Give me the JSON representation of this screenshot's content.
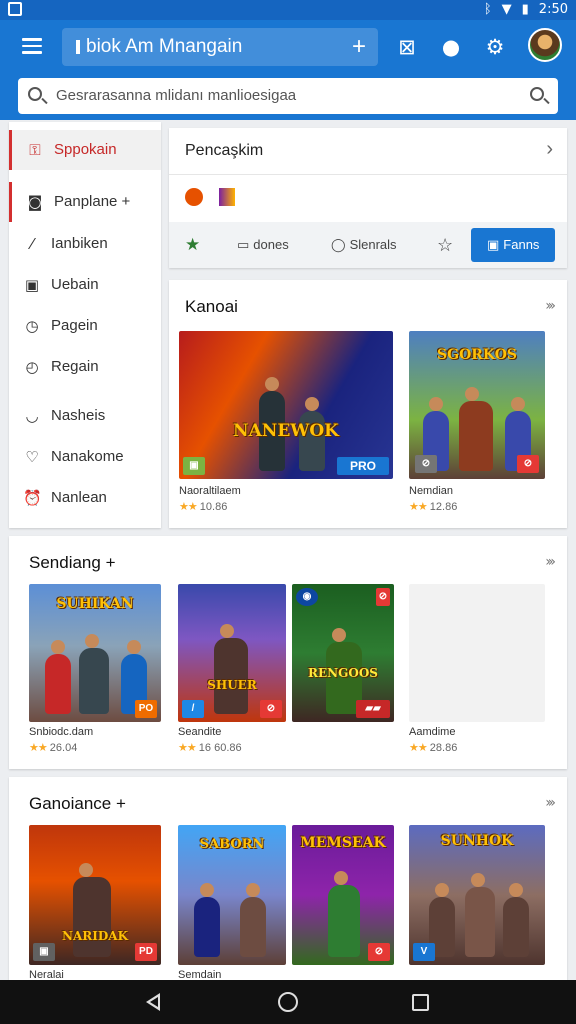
{
  "statusbar": {
    "time": "2:50"
  },
  "appbar": {
    "title": "biok Am Mnangain",
    "plus": "+"
  },
  "search": {
    "placeholder": "Gesrarasanna mlidanı manlioesigaa"
  },
  "sidebar": {
    "items": [
      {
        "label": "Sppokain",
        "icon": "lock-icon",
        "glyph": "🔒"
      },
      {
        "label": "Panplane +",
        "icon": "gamepad-icon",
        "glyph": "◙"
      },
      {
        "label": "Ianbiken",
        "icon": "brush-icon",
        "glyph": "/"
      },
      {
        "label": "Uebain",
        "icon": "grid-icon",
        "glyph": "▣"
      },
      {
        "label": "Pagein",
        "icon": "clock-icon",
        "glyph": "◷"
      },
      {
        "label": "Regain",
        "icon": "timer-icon",
        "glyph": "◴"
      },
      {
        "label": "Nasheis",
        "icon": "shield-icon",
        "glyph": "♡"
      },
      {
        "label": "Nanakome",
        "icon": "heart-icon",
        "glyph": "♡"
      },
      {
        "label": "Nanlean",
        "icon": "alarm-icon",
        "glyph": "⏰"
      }
    ]
  },
  "panel": {
    "title": "Pencaşkim",
    "tabs": [
      {
        "label": "",
        "icon": "star-icon",
        "glyph": "★"
      },
      {
        "label": "dones",
        "icon": "window-icon",
        "glyph": "▭"
      },
      {
        "label": "Slenrals",
        "icon": "shield-icon",
        "glyph": "◯"
      },
      {
        "label": "",
        "icon": "star-outline-icon",
        "glyph": "☆"
      },
      {
        "label": "Fanns",
        "icon": "square-icon",
        "glyph": "▣"
      }
    ]
  },
  "sections": [
    {
      "title": "Kanoai",
      "games": [
        {
          "name": "Naoraltilaem",
          "rating": "10.86",
          "art": "NANEWOK",
          "badge": "PRO"
        },
        {
          "name": "Nemdian",
          "rating": "12.86",
          "art": "SGORKOS",
          "badge": "⊘"
        }
      ]
    },
    {
      "title": "Sendiang +",
      "games": [
        {
          "name": "Snbiodc.dam",
          "rating": "26.04",
          "art": "SUHIKAN",
          "badge": "PO"
        },
        {
          "name": "Seandite",
          "rating": "16 60.86",
          "art": "SHUER",
          "badge": "⊘"
        },
        {
          "name": "",
          "rating": "",
          "art": "RENGOOS",
          "badge": "⊘"
        },
        {
          "name": "Aamdime",
          "rating": "28.86",
          "art": "",
          "badge": ""
        }
      ]
    },
    {
      "title": "Ganoiance +",
      "games": [
        {
          "name": "Neralai",
          "rating": "",
          "art": "NARIDAK",
          "badge": "PD"
        },
        {
          "name": "Semdain",
          "rating": "",
          "art": "SABORN",
          "badge": ""
        },
        {
          "name": "",
          "rating": "",
          "art": "MEMSEAK",
          "badge": "⊘"
        },
        {
          "name": "",
          "rating": "",
          "art": "SUNHOK",
          "badge": "V"
        }
      ]
    }
  ],
  "colors": {
    "primary": "#1976d2",
    "accent": "#d32f2f"
  }
}
